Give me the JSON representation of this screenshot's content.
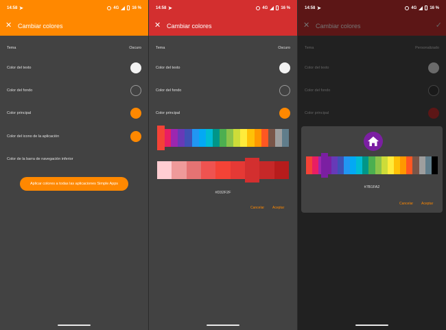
{
  "status": {
    "time": "14:58",
    "network": "4G",
    "battery": "16 %"
  },
  "colors": {
    "orange": "#ff8800",
    "red": "#d32f2f",
    "dark_red": "#5c1616",
    "purple": "#7b1fa2",
    "dark_bg": "#424242",
    "dim_bg": "#212121"
  },
  "panel1": {
    "title": "Cambiar colores",
    "tema_label": "Tema",
    "tema_value": "Oscuro",
    "rows": [
      {
        "label": "Color del texto"
      },
      {
        "label": "Color del fondo"
      },
      {
        "label": "Color principal"
      },
      {
        "label": "Color del icono de la aplicación"
      },
      {
        "label": "Color de la barra de navegación inferior"
      }
    ],
    "apply_button": "Aplicar colores a todas las aplicaciones Simple Apps"
  },
  "panel2": {
    "title": "Cambiar colores",
    "tema_label": "Tema",
    "tema_value": "Oscuro",
    "rows": [
      {
        "label": "Color del texto"
      },
      {
        "label": "Color del fondo"
      },
      {
        "label": "Color principal"
      }
    ],
    "hue_palette": [
      "#f44336",
      "#e91e63",
      "#9c27b0",
      "#673ab7",
      "#3f51b5",
      "#2196f3",
      "#03a9f4",
      "#00bcd4",
      "#009688",
      "#4caf50",
      "#8bc34a",
      "#cddc39",
      "#ffeb3b",
      "#ffc107",
      "#ff9800",
      "#ff5722",
      "#795548",
      "#9e9e9e",
      "#607d8b"
    ],
    "shade_palette": [
      "#ffcdd2",
      "#ef9a9a",
      "#e57373",
      "#ef5350",
      "#f44336",
      "#e53935",
      "#d32f2f",
      "#c62828",
      "#b71c1c"
    ],
    "hex": "#D32F2F",
    "cancel": "Cancelar",
    "accept": "Aceptar"
  },
  "panel3": {
    "title": "Cambiar colores",
    "tema_label": "Tema",
    "tema_value": "Personalizado",
    "rows": [
      {
        "label": "Color del texto"
      },
      {
        "label": "Color del fondo"
      },
      {
        "label": "Color principal"
      }
    ],
    "icon": "home-icon",
    "palette": [
      "#f44336",
      "#e91e63",
      "#9c27b0",
      "#7b1fa2",
      "#673ab7",
      "#3f51b5",
      "#2196f3",
      "#03a9f4",
      "#00bcd4",
      "#009688",
      "#4caf50",
      "#8bc34a",
      "#cddc39",
      "#ffeb3b",
      "#ffc107",
      "#ff9800",
      "#ff5722",
      "#795548",
      "#9e9e9e",
      "#607d8b",
      "#000000"
    ],
    "hex": "#7B1FA2",
    "cancel": "Cancelar",
    "accept": "Aceptar"
  }
}
